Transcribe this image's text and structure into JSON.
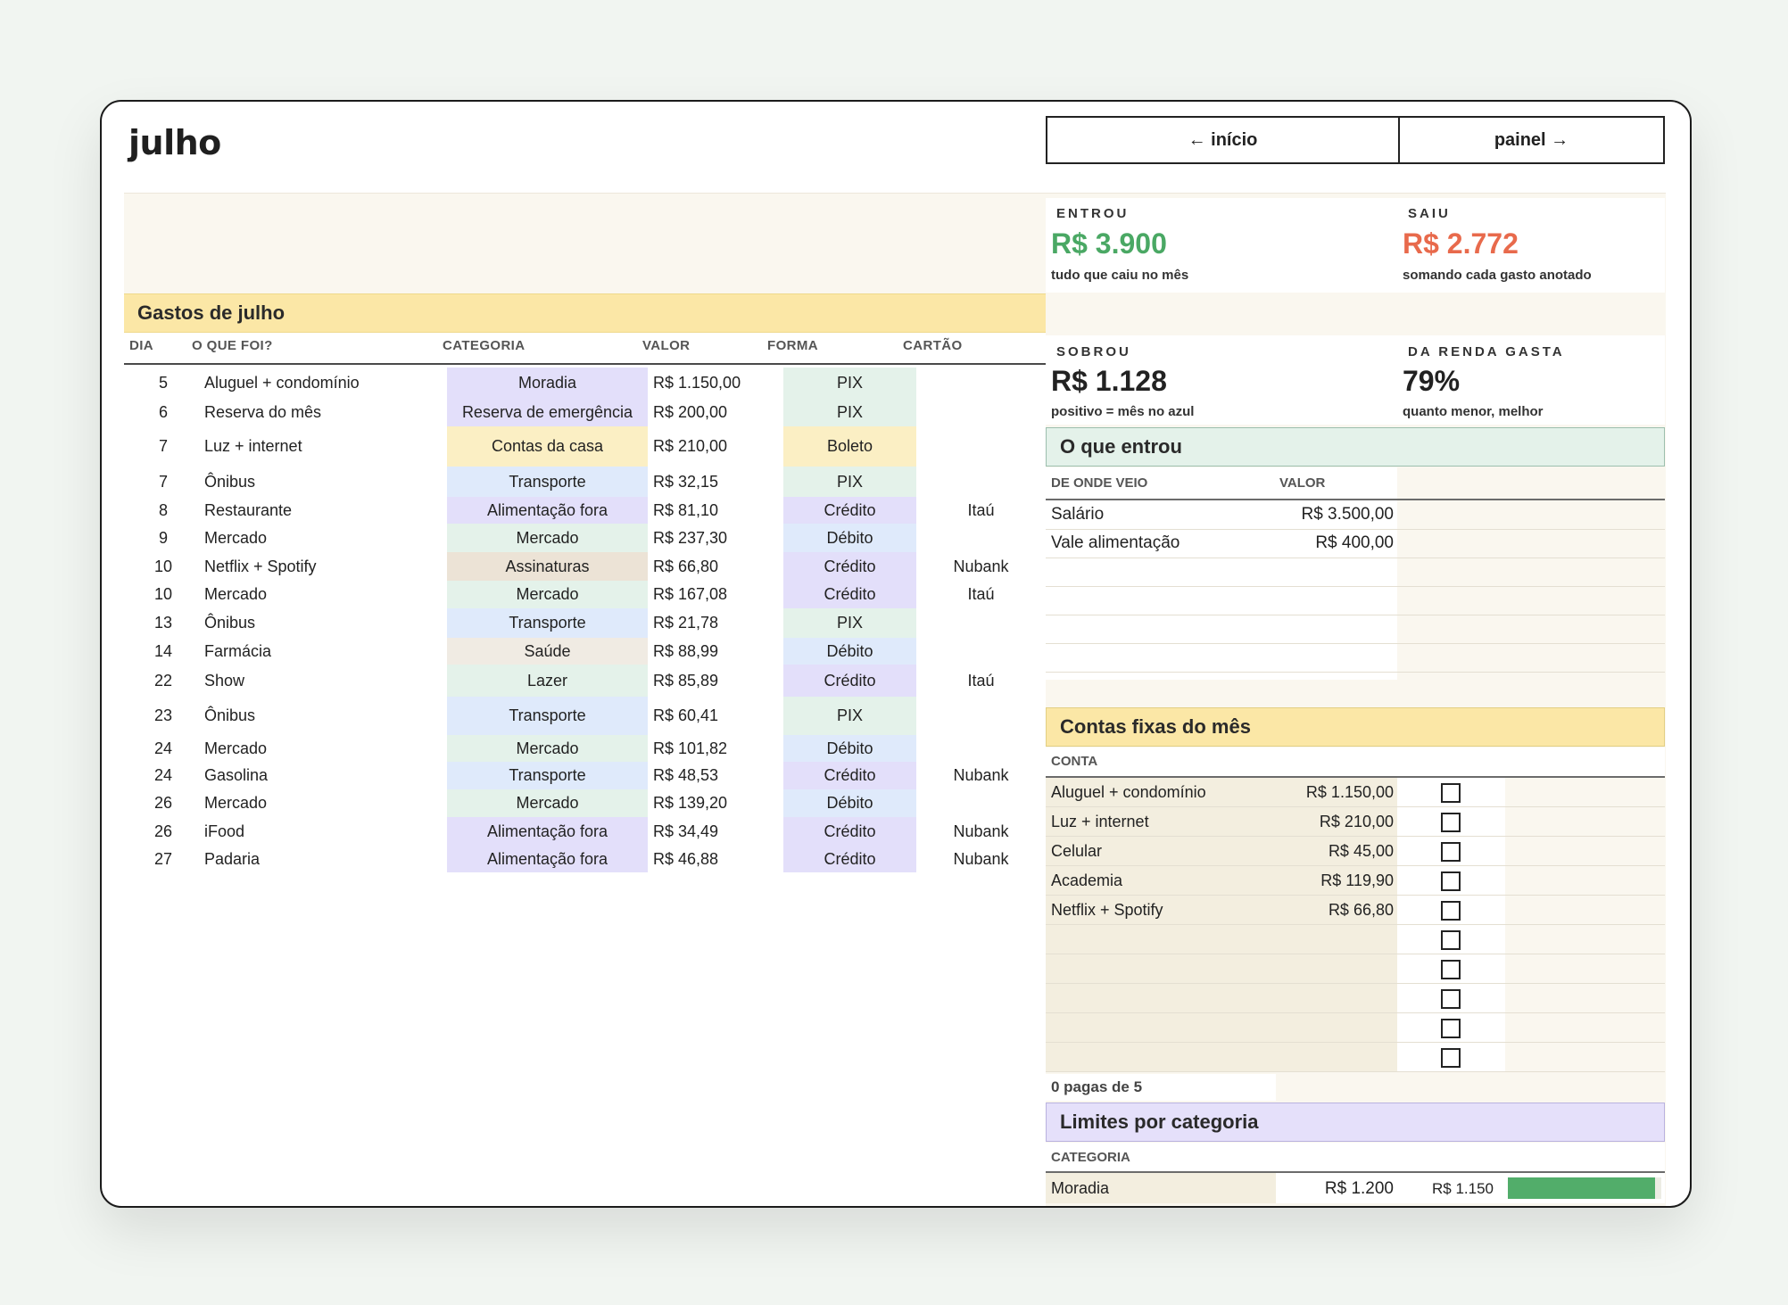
{
  "title": "julho",
  "nav": {
    "back": "← início",
    "panel": "painel →"
  },
  "kpis": {
    "entrou": {
      "label": "ENTROU",
      "value": "R$ 3.900",
      "sub": "tudo que caiu no mês"
    },
    "saiu": {
      "label": "SAIU",
      "value": "R$ 2.772",
      "sub": "somando cada gasto anotado"
    },
    "sobrou": {
      "label": "SOBROU",
      "value": "R$ 1.128",
      "sub": "positivo = mês no azul"
    },
    "renda": {
      "label": "DA RENDA GASTA",
      "value": "79%",
      "sub": "quanto menor, melhor"
    }
  },
  "colors": {
    "green": "#4aa864",
    "red": "#e86a4c",
    "bar": "#52ad6a"
  },
  "expenses": {
    "title": "Gastos de julho",
    "columns": [
      "DIA",
      "O QUE FOI?",
      "CATEGORIA",
      "VALOR",
      "FORMA",
      "CARTÃO"
    ],
    "rows": [
      {
        "day": "5",
        "desc": "Aluguel + condomínio",
        "cat": "Moradia",
        "value": "R$ 1.150,00",
        "form": "PIX",
        "card": ""
      },
      {
        "day": "6",
        "desc": "Reserva do mês",
        "cat": "Reserva de emergência",
        "value": "R$ 200,00",
        "form": "PIX",
        "card": ""
      },
      {
        "day": "7",
        "desc": "Luz + internet",
        "cat": "Contas da casa",
        "value": "R$ 210,00",
        "form": "Boleto",
        "card": ""
      },
      {
        "day": "7",
        "desc": "Ônibus",
        "cat": "Transporte",
        "value": "R$ 32,15",
        "form": "PIX",
        "card": ""
      },
      {
        "day": "8",
        "desc": "Restaurante",
        "cat": "Alimentação fora",
        "value": "R$ 81,10",
        "form": "Crédito",
        "card": "Itaú"
      },
      {
        "day": "9",
        "desc": "Mercado",
        "cat": "Mercado",
        "value": "R$ 237,30",
        "form": "Débito",
        "card": ""
      },
      {
        "day": "10",
        "desc": "Netflix + Spotify",
        "cat": "Assinaturas",
        "value": "R$ 66,80",
        "form": "Crédito",
        "card": "Nubank"
      },
      {
        "day": "10",
        "desc": "Mercado",
        "cat": "Mercado",
        "value": "R$ 167,08",
        "form": "Crédito",
        "card": "Itaú"
      },
      {
        "day": "13",
        "desc": "Ônibus",
        "cat": "Transporte",
        "value": "R$ 21,78",
        "form": "PIX",
        "card": ""
      },
      {
        "day": "14",
        "desc": "Farmácia",
        "cat": "Saúde",
        "value": "R$ 88,99",
        "form": "Débito",
        "card": ""
      },
      {
        "day": "22",
        "desc": "Show",
        "cat": "Lazer",
        "value": "R$ 85,89",
        "form": "Crédito",
        "card": "Itaú"
      },
      {
        "day": "23",
        "desc": "Ônibus",
        "cat": "Transporte",
        "value": "R$ 60,41",
        "form": "PIX",
        "card": ""
      },
      {
        "day": "24",
        "desc": "Mercado",
        "cat": "Mercado",
        "value": "R$ 101,82",
        "form": "Débito",
        "card": ""
      },
      {
        "day": "24",
        "desc": "Gasolina",
        "cat": "Transporte",
        "value": "R$ 48,53",
        "form": "Crédito",
        "card": "Nubank"
      },
      {
        "day": "26",
        "desc": "Mercado",
        "cat": "Mercado",
        "value": "R$ 139,20",
        "form": "Débito",
        "card": ""
      },
      {
        "day": "26",
        "desc": "iFood",
        "cat": "Alimentação fora",
        "value": "R$ 34,49",
        "form": "Crédito",
        "card": "Nubank"
      },
      {
        "day": "27",
        "desc": "Padaria",
        "cat": "Alimentação fora",
        "value": "R$ 46,88",
        "form": "Crédito",
        "card": "Nubank"
      }
    ]
  },
  "income": {
    "title": "O que entrou",
    "columns": [
      "DE ONDE VEIO",
      "VALOR"
    ],
    "rows": [
      {
        "source": "Salário",
        "value": "R$ 3.500,00"
      },
      {
        "source": "Vale alimentação",
        "value": "R$ 400,00"
      }
    ]
  },
  "fixed": {
    "title": "Contas fixas do mês",
    "column": "CONTA",
    "rows": [
      {
        "name": "Aluguel + condomínio",
        "value": "R$ 1.150,00"
      },
      {
        "name": "Luz + internet",
        "value": "R$ 210,00"
      },
      {
        "name": "Celular",
        "value": "R$ 45,00"
      },
      {
        "name": "Academia",
        "value": "R$ 119,90"
      },
      {
        "name": "Netflix + Spotify",
        "value": "R$ 66,80"
      }
    ],
    "paid_count": "0 pagas de 5"
  },
  "limits": {
    "title": "Limites por categoria",
    "column": "CATEGORIA",
    "rows": [
      {
        "category": "Moradia",
        "limit": "R$ 1.200",
        "spent": "R$ 1.150",
        "fill": 0.96
      }
    ]
  }
}
